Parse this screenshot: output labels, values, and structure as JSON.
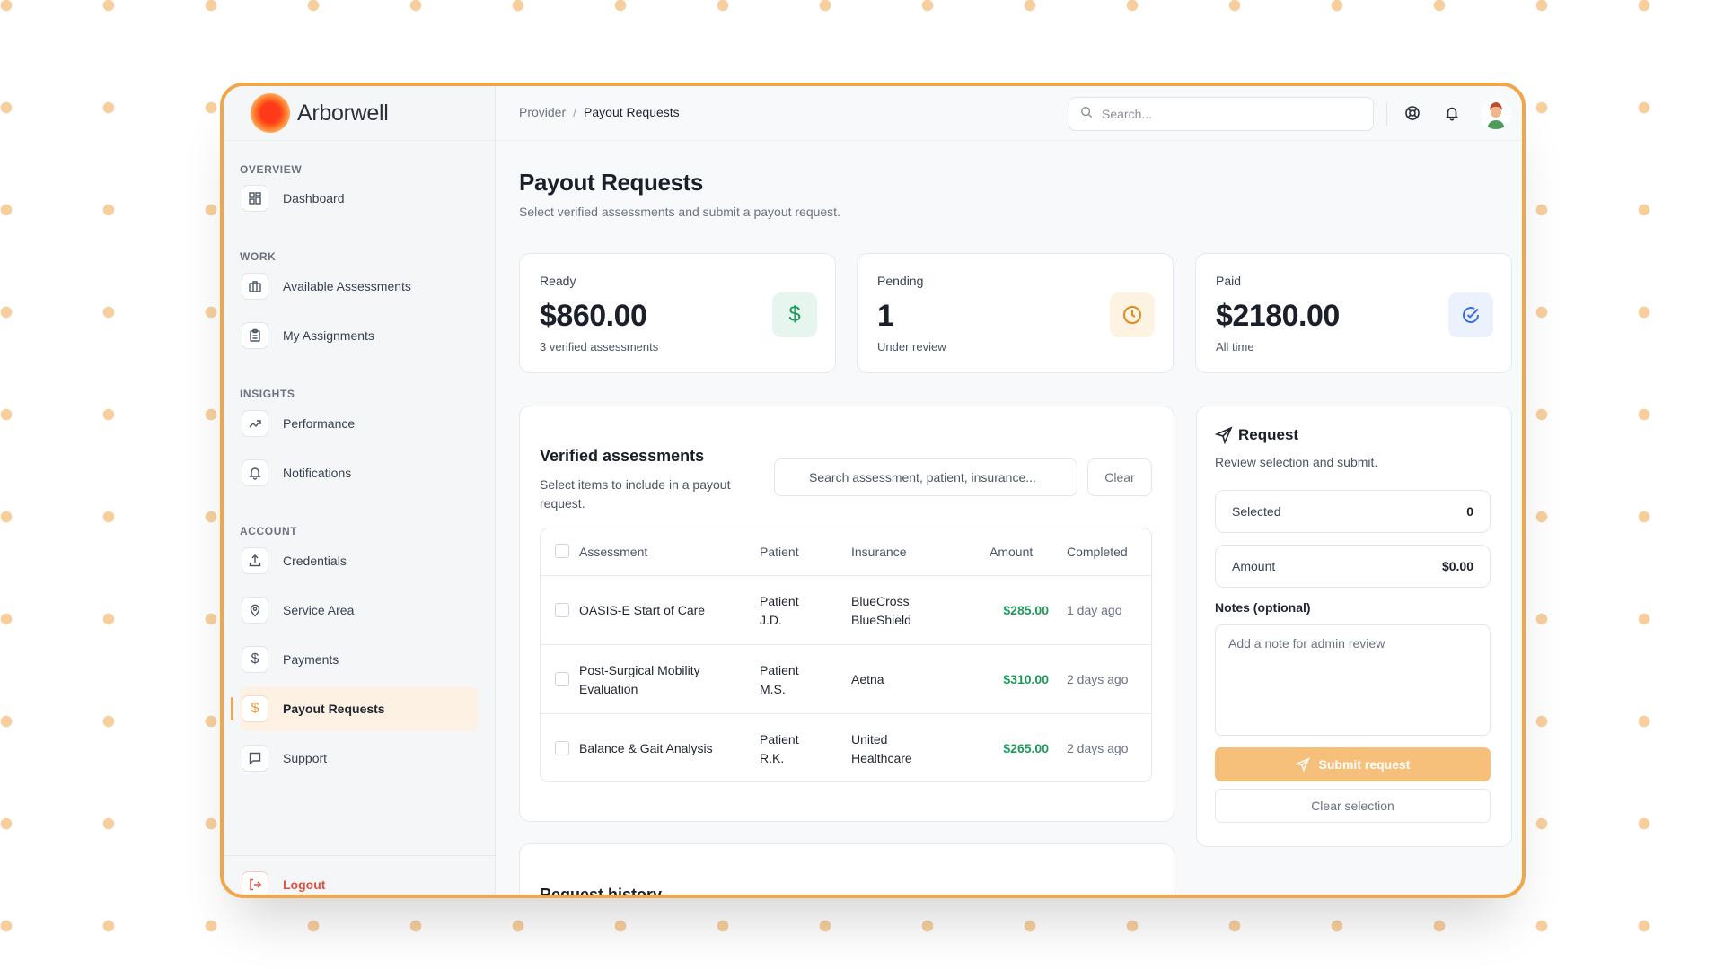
{
  "brand": {
    "name": "Arborwell"
  },
  "sidebar": {
    "sections": [
      "OVERVIEW",
      "WORK",
      "INSIGHTS",
      "ACCOUNT"
    ],
    "items": [
      {
        "label": "Dashboard",
        "icon": "dashboard-grid-icon"
      },
      {
        "label": "Available Assessments",
        "icon": "briefcase-icon"
      },
      {
        "label": "My Assignments",
        "icon": "clipboard-icon"
      },
      {
        "label": "Performance",
        "icon": "trending-up-icon"
      },
      {
        "label": "Notifications",
        "icon": "bell-icon"
      },
      {
        "label": "Credentials",
        "icon": "upload-icon"
      },
      {
        "label": "Service Area",
        "icon": "map-pin-icon"
      },
      {
        "label": "Payments",
        "icon": "dollar-icon"
      },
      {
        "label": "Payout Requests",
        "icon": "dollar-icon",
        "active": true
      },
      {
        "label": "Support",
        "icon": "message-square-icon"
      }
    ],
    "logout": "Logout"
  },
  "header": {
    "breadcrumb": [
      "Provider",
      "Payout Requests"
    ],
    "search_placeholder": "Search..."
  },
  "page": {
    "title": "Payout Requests",
    "subtitle": "Select verified assessments and submit a payout request."
  },
  "stats": [
    {
      "title": "Ready",
      "value": "$860.00",
      "sub": "3 verified assessments",
      "icon": "dollar-icon",
      "color": "#1f9a5b"
    },
    {
      "title": "Pending",
      "value": "1",
      "sub": "Under review",
      "icon": "clock-icon",
      "color": "#e08a1e"
    },
    {
      "title": "Paid",
      "value": "$2180.00",
      "sub": "All time",
      "icon": "check-circle-icon",
      "color": "#3b6fe0"
    }
  ],
  "verified": {
    "title": "Verified assessments",
    "subtitle": "Select items to include in a payout request.",
    "search_placeholder": "Search assessment, patient, insurance...",
    "clear_label": "Clear",
    "columns": [
      "Assessment",
      "Patient",
      "Insurance",
      "Amount",
      "Completed"
    ],
    "rows": [
      {
        "assessment": "OASIS-E Start of Care",
        "patient": "Patient J.D.",
        "insurance": "BlueCross BlueShield",
        "amount": "$285.00",
        "completed": "1 day ago"
      },
      {
        "assessment": "Post-Surgical Mobility Evaluation",
        "patient": "Patient M.S.",
        "insurance": "Aetna",
        "amount": "$310.00",
        "completed": "2 days ago"
      },
      {
        "assessment": "Balance & Gait Analysis",
        "patient": "Patient R.K.",
        "insurance": "United Healthcare",
        "amount": "$265.00",
        "completed": "2 days ago"
      }
    ]
  },
  "request": {
    "title": "Request",
    "subtitle": "Review selection and submit.",
    "selected_label": "Selected",
    "selected_value": "0",
    "amount_label": "Amount",
    "amount_value": "$0.00",
    "notes_label": "Notes (optional)",
    "notes_placeholder": "Add a note for admin review",
    "submit_label": "Submit request",
    "clear_label": "Clear selection"
  },
  "history": {
    "title": "Request history"
  },
  "colors": {
    "accent": "#f0a64b",
    "money": "#1f9a5b",
    "danger": "#e0523f"
  }
}
